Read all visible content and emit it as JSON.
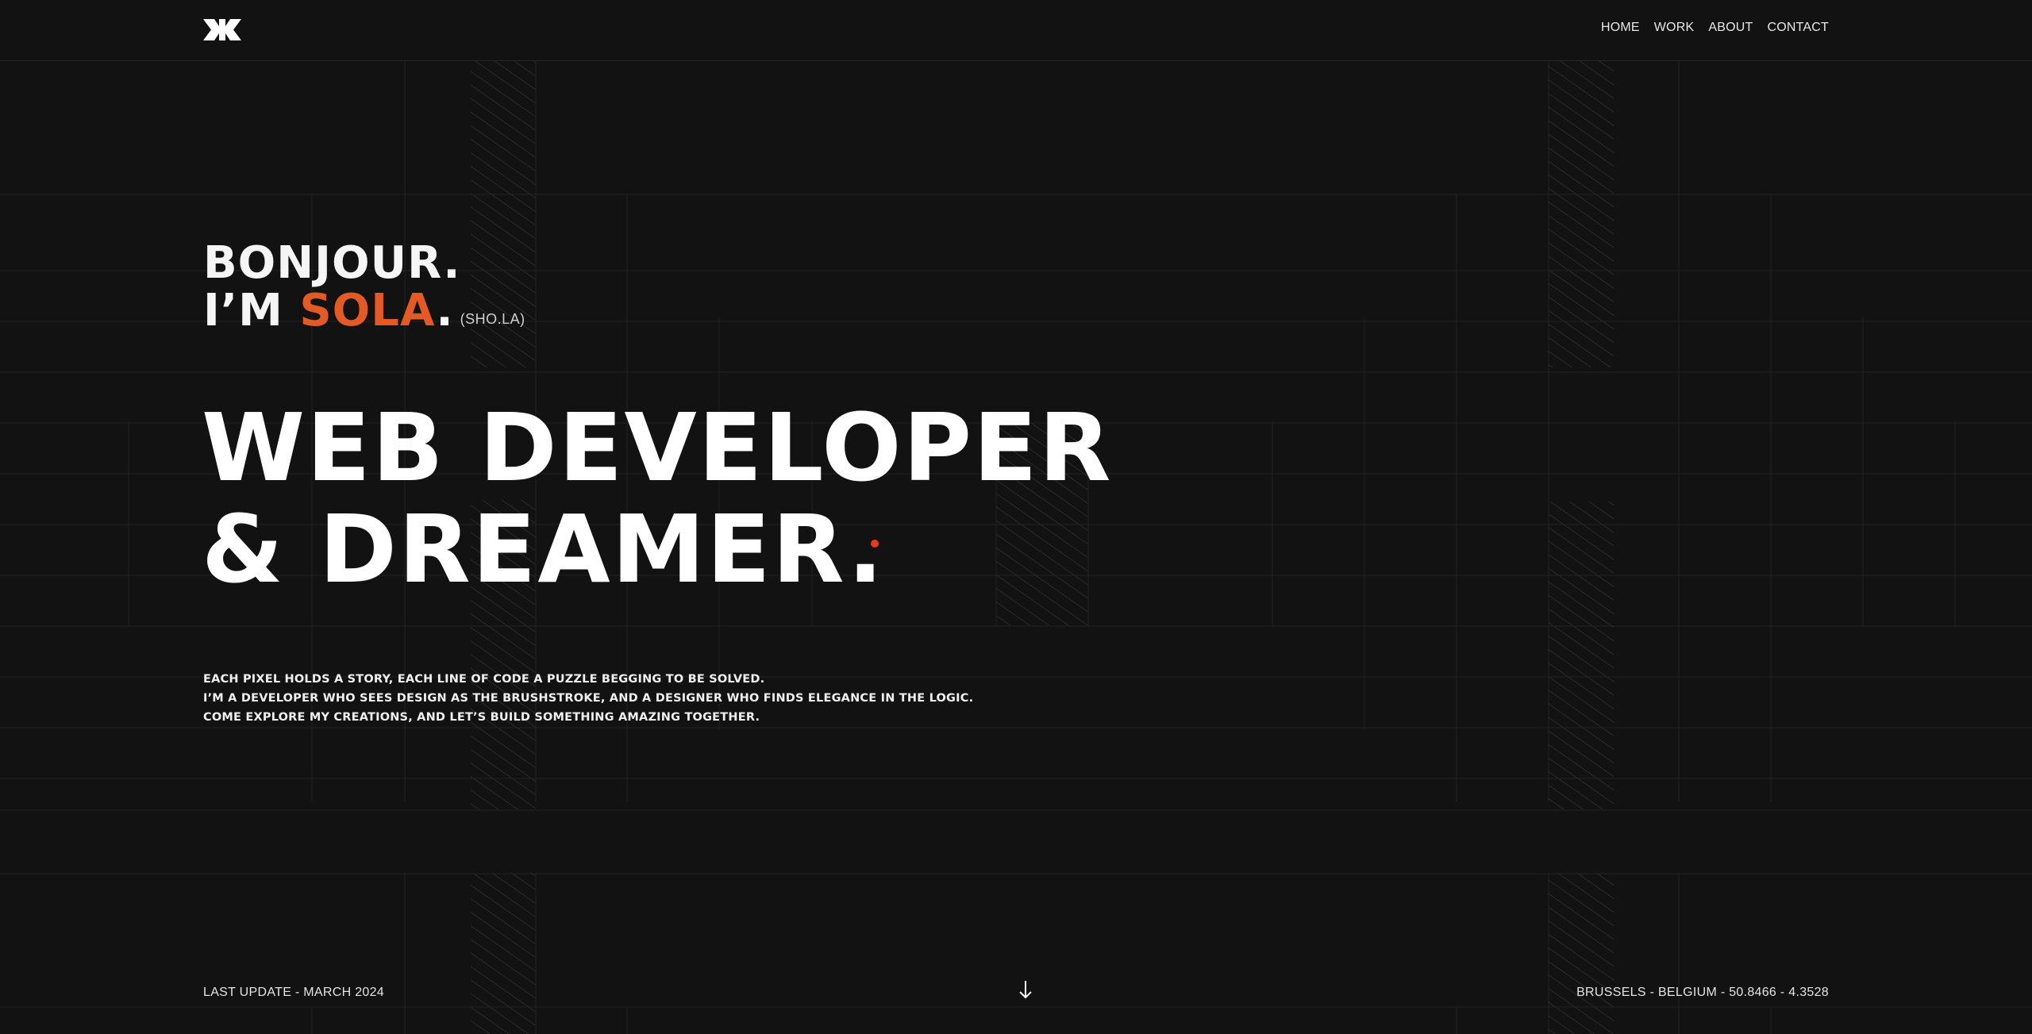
{
  "header": {
    "logo_icon": "monogram-logo-icon",
    "nav": [
      "HOME",
      "WORK",
      "ABOUT",
      "CONTACT"
    ]
  },
  "hero": {
    "greeting": "BONJOUR.",
    "intro_prefix": "I’M",
    "name": "SOLA",
    "name_period": ".",
    "pronunciation": "(SHO.LA)",
    "headline": [
      "WEB DEVELOPER",
      "& DREAMER."
    ],
    "bio": [
      "EACH PIXEL HOLDS A STORY, EACH LINE OF CODE A PUZZLE BEGGING TO BE SOLVED.",
      "I’M A DEVELOPER WHO SEES DESIGN AS THE BRUSHSTROKE, AND A DESIGNER WHO FINDS ELEGANCE IN THE LOGIC.",
      "COME EXPLORE MY CREATIONS, AND LET’S BUILD SOMETHING AMAZING TOGETHER."
    ]
  },
  "footer": {
    "last_update": "LAST UPDATE - MARCH 2024",
    "scroll_icon": "arrow-down-icon",
    "location": "BRUSSELS - BELGIUM - 50.8466 - 4.3528"
  },
  "colors": {
    "background": "#121212",
    "accent": "#e35a26",
    "dot": "#e8391f",
    "grid_line": "#242424",
    "text": "#ffffff"
  }
}
